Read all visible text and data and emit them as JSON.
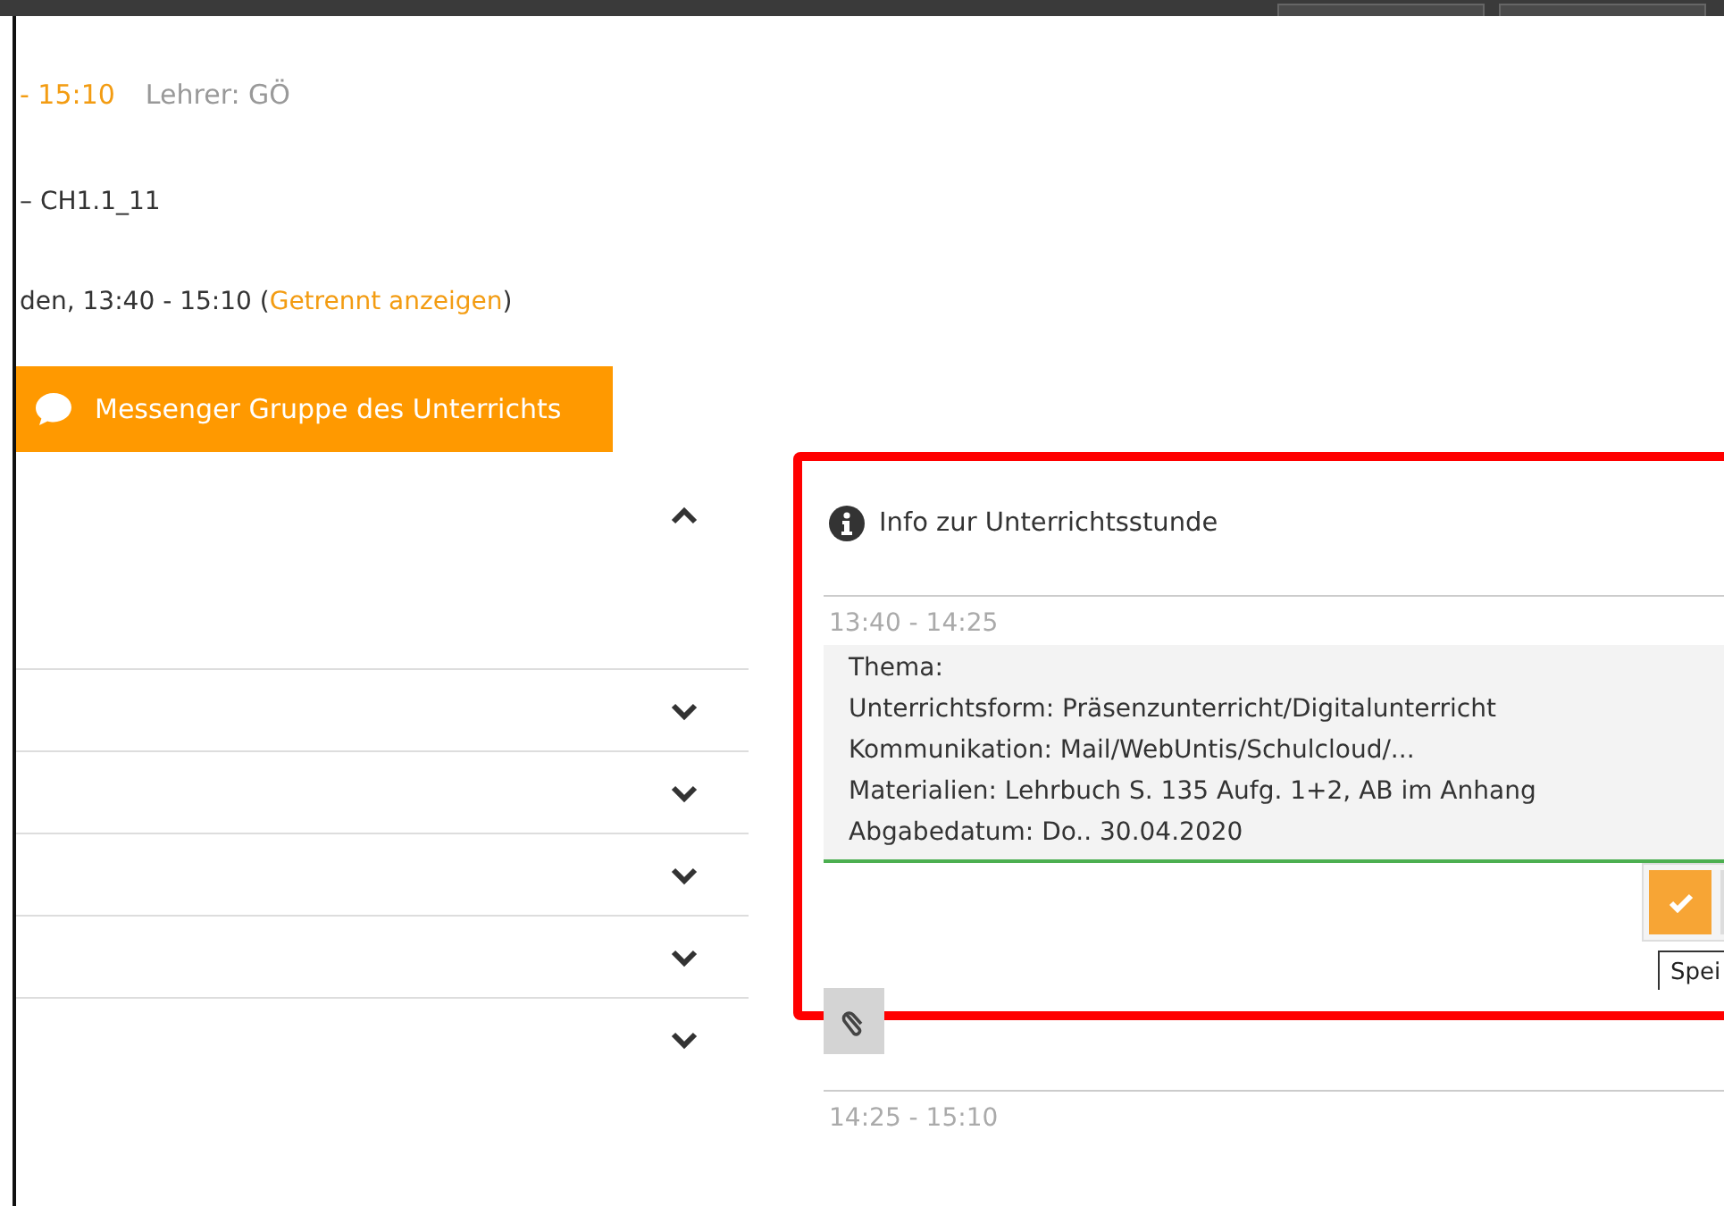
{
  "header": {
    "time": "- 15:10",
    "teacher": "Lehrer: GÖ",
    "room": "– CH1.1_11",
    "periods": "den, 13:40 - 15:10 (",
    "separate_link": "Getrennt anzeigen",
    "periods_end": ")",
    "messenger_button": "Messenger Gruppe des Unterrichts"
  },
  "accordion": [
    {
      "expanded": true
    },
    {
      "expanded": false
    },
    {
      "expanded": false
    },
    {
      "expanded": false
    },
    {
      "expanded": false
    },
    {
      "expanded": false
    }
  ],
  "info_panel": {
    "title": "Info zur Unterrichtsstunde",
    "highlighted": true,
    "slots": [
      {
        "time": "13:40 - 14:25",
        "text": "Thema:\nUnterrichtsform: Präsenzunterricht/Digitalunterricht\nKommunikation: Mail/WebUntis/Schulcloud/...\nMaterialien: Lehrbuch S. 135 Aufg. 1+2, AB im Anhang\nAbgabedatum: Do.. 30.04.2020",
        "editing": true,
        "tooltip": "Spei"
      },
      {
        "time": "14:25 - 15:10",
        "editing": false
      }
    ]
  }
}
